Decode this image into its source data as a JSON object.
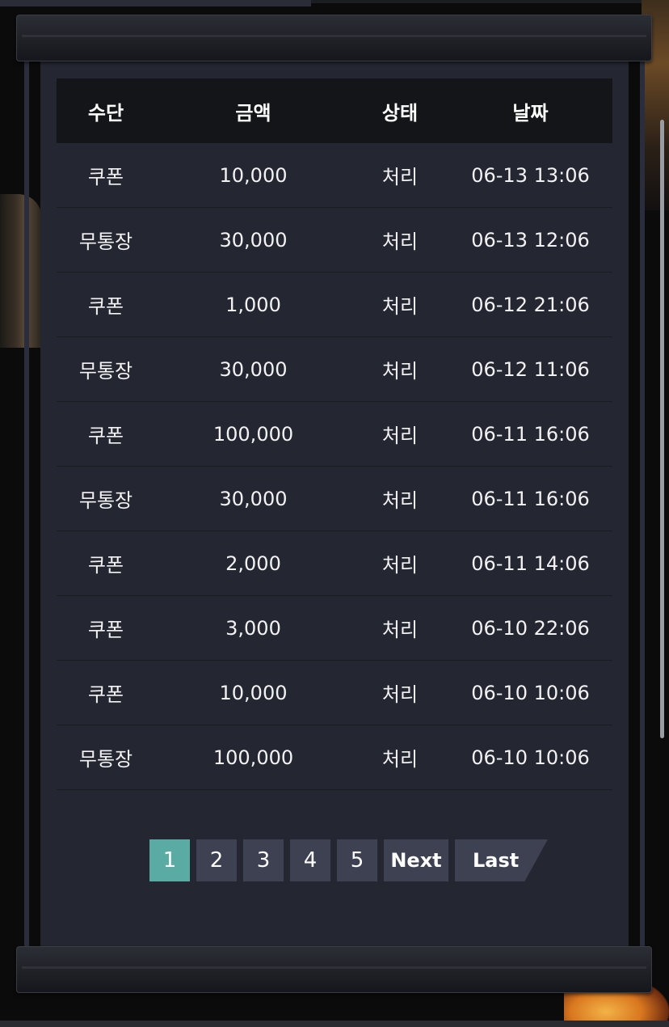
{
  "table": {
    "headers": [
      "수단",
      "금액",
      "상태",
      "날짜"
    ],
    "rows": [
      {
        "method": "쿠폰",
        "amount": "10,000",
        "status": "처리",
        "date": "06-13 13:06"
      },
      {
        "method": "무통장",
        "amount": "30,000",
        "status": "처리",
        "date": "06-13 12:06"
      },
      {
        "method": "쿠폰",
        "amount": "1,000",
        "status": "처리",
        "date": "06-12 21:06"
      },
      {
        "method": "무통장",
        "amount": "30,000",
        "status": "처리",
        "date": "06-12 11:06"
      },
      {
        "method": "쿠폰",
        "amount": "100,000",
        "status": "처리",
        "date": "06-11 16:06"
      },
      {
        "method": "무통장",
        "amount": "30,000",
        "status": "처리",
        "date": "06-11 16:06"
      },
      {
        "method": "쿠폰",
        "amount": "2,000",
        "status": "처리",
        "date": "06-11 14:06"
      },
      {
        "method": "쿠폰",
        "amount": "3,000",
        "status": "처리",
        "date": "06-10 22:06"
      },
      {
        "method": "쿠폰",
        "amount": "10,000",
        "status": "처리",
        "date": "06-10 10:06"
      },
      {
        "method": "무통장",
        "amount": "100,000",
        "status": "처리",
        "date": "06-10 10:06"
      }
    ]
  },
  "pagination": {
    "pages": [
      "1",
      "2",
      "3",
      "4",
      "5"
    ],
    "active_page": "1",
    "next_label": "Next",
    "last_label": "Last"
  },
  "colors": {
    "panel": "#242731",
    "header": "#141519",
    "active_page": "#5aaba4",
    "page_button": "#3d4152"
  }
}
